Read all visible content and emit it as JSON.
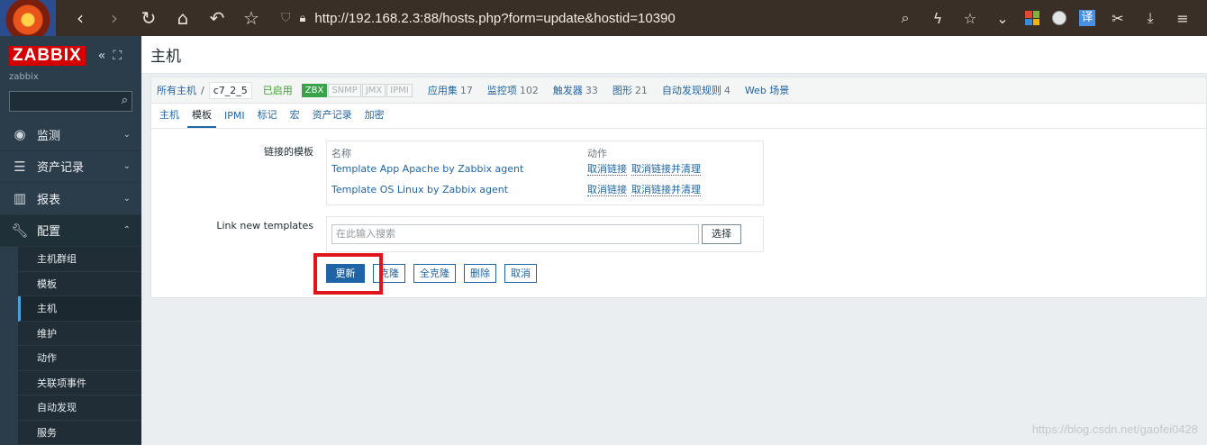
{
  "browser": {
    "url": "http://192.168.2.3:88/hosts.php?form=update&hostid=10390",
    "nav_icons": [
      "back-icon",
      "forward-icon",
      "reload-icon",
      "home-icon",
      "undo-icon",
      "bookmark-star-icon"
    ],
    "translate_label": "译"
  },
  "sidebar": {
    "logo": "ZABBIX",
    "server": "zabbix",
    "search_value": "",
    "menu": [
      {
        "label": "监测",
        "icon": "eye-icon"
      },
      {
        "label": "资产记录",
        "icon": "list-icon"
      },
      {
        "label": "报表",
        "icon": "bar-chart-icon"
      },
      {
        "label": "配置",
        "icon": "wrench-icon"
      }
    ],
    "submenu": [
      "主机群组",
      "模板",
      "主机",
      "维护",
      "动作",
      "关联项事件",
      "自动发现",
      "服务"
    ]
  },
  "header": {
    "title": "主机"
  },
  "crumbs": {
    "all_hosts": "所有主机",
    "sep": "/",
    "host": "c7_2_5",
    "status": "已启用",
    "badges": [
      "ZBX",
      "SNMP",
      "JMX",
      "IPMI"
    ],
    "links": [
      {
        "label": "应用集",
        "count": "17"
      },
      {
        "label": "监控项",
        "count": "102"
      },
      {
        "label": "触发器",
        "count": "33"
      },
      {
        "label": "图形",
        "count": "21"
      },
      {
        "label": "自动发现规则",
        "count": "4"
      },
      {
        "label": "Web 场景",
        "count": ""
      }
    ]
  },
  "tabs": [
    "主机",
    "模板",
    "IPMI",
    "标记",
    "宏",
    "资产记录",
    "加密"
  ],
  "form": {
    "linked_label": "链接的模板",
    "col_name": "名称",
    "col_action": "动作",
    "templates": [
      {
        "name": "Template App Apache by Zabbix agent",
        "unlink": "取消链接",
        "unlink_clear": "取消链接并清理"
      },
      {
        "name": "Template OS Linux by Zabbix agent",
        "unlink": "取消链接",
        "unlink_clear": "取消链接并清理"
      }
    ],
    "new_label": "Link new templates",
    "search_placeholder": "在此输入搜索",
    "select_button": "选择",
    "buttons": {
      "update": "更新",
      "clone": "克隆",
      "full_clone": "全克隆",
      "delete": "删除",
      "cancel": "取消"
    }
  },
  "watermark": "https://blog.csdn.net/gaofei0428"
}
